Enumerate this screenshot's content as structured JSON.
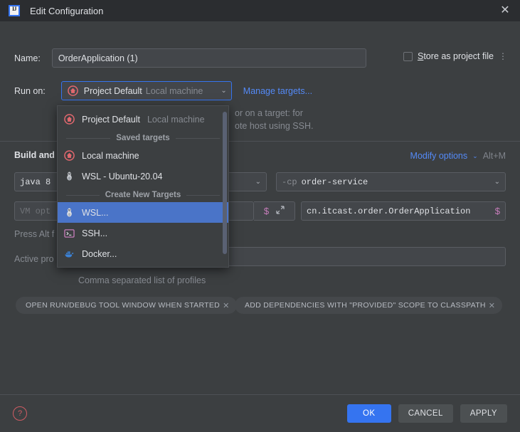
{
  "window": {
    "title": "Edit Configuration",
    "app_icon": "intellij-idea-logo",
    "close_icon": "✕"
  },
  "form": {
    "name_label": "Name:",
    "name_value": "OrderApplication (1)",
    "store_as_project_file_label": "Store as project file",
    "store_as_project_file_checked": false,
    "kebab_icon": "⋮",
    "run_on_label": "Run on:",
    "run_on_value": "Project Default",
    "run_on_value_sub": "Local machine",
    "run_on_icon": "target-home-icon",
    "manage_targets_link": "Manage targets...",
    "help_text_line1": "or on a target: for",
    "help_text_line2": "ote host using SSH.",
    "build_and_run_header": "Build and run",
    "modify_options_link": "Modify options",
    "modify_options_shortcut": "Alt+M",
    "jdk_value": "java 8",
    "classpath_flag": "-cp",
    "classpath_value": "order-service",
    "vm_options_placeholder": "VM opt",
    "vm_macro_icon": "$",
    "vm_expand_icon": "expand-arrows-icon",
    "main_class_value": "cn.itcast.order.OrderApplication",
    "main_class_macro_icon": "$",
    "press_alt_hint": "Press Alt f",
    "active_profiles_label": "Active pro",
    "active_profiles_value": "",
    "comma_hint": "Comma separated list of profiles",
    "option_chips": [
      {
        "label": "OPEN RUN/DEBUG TOOL WINDOW WHEN STARTED",
        "close_icon": "✕"
      },
      {
        "label": "ADD DEPENDENCIES WITH \"PROVIDED\" SCOPE TO CLASSPATH",
        "close_icon": "✕"
      }
    ]
  },
  "popup": {
    "current_item": {
      "label": "Project Default",
      "sub": "Local machine",
      "icon": "target-home-icon"
    },
    "groups": [
      {
        "title": "Saved targets",
        "items": [
          {
            "label": "Local machine",
            "icon": "target-home-icon",
            "selected": false
          },
          {
            "label": "WSL - Ubuntu-20.04",
            "icon": "linux-penguin-icon",
            "selected": false
          }
        ]
      },
      {
        "title": "Create New Targets",
        "items": [
          {
            "label": "WSL...",
            "icon": "linux-penguin-icon",
            "selected": true
          },
          {
            "label": "SSH...",
            "icon": "terminal-icon",
            "selected": false
          },
          {
            "label": "Docker...",
            "icon": "docker-whale-icon",
            "selected": false
          }
        ]
      }
    ]
  },
  "footer": {
    "help_icon": "?",
    "ok_label": "OK",
    "cancel_label": "CANCEL",
    "apply_label": "APPLY"
  },
  "colors": {
    "accent_blue": "#3574f0",
    "link_blue": "#548af7",
    "selection_blue": "#4a74c8",
    "dialog_bg": "#3c3f41",
    "titlebar_bg": "#2b2d30",
    "field_bg": "#43464a",
    "text": "#dfe1e5",
    "muted_text": "#868a91",
    "macro_purple": "#c77dbb",
    "help_red": "#d05c63"
  }
}
